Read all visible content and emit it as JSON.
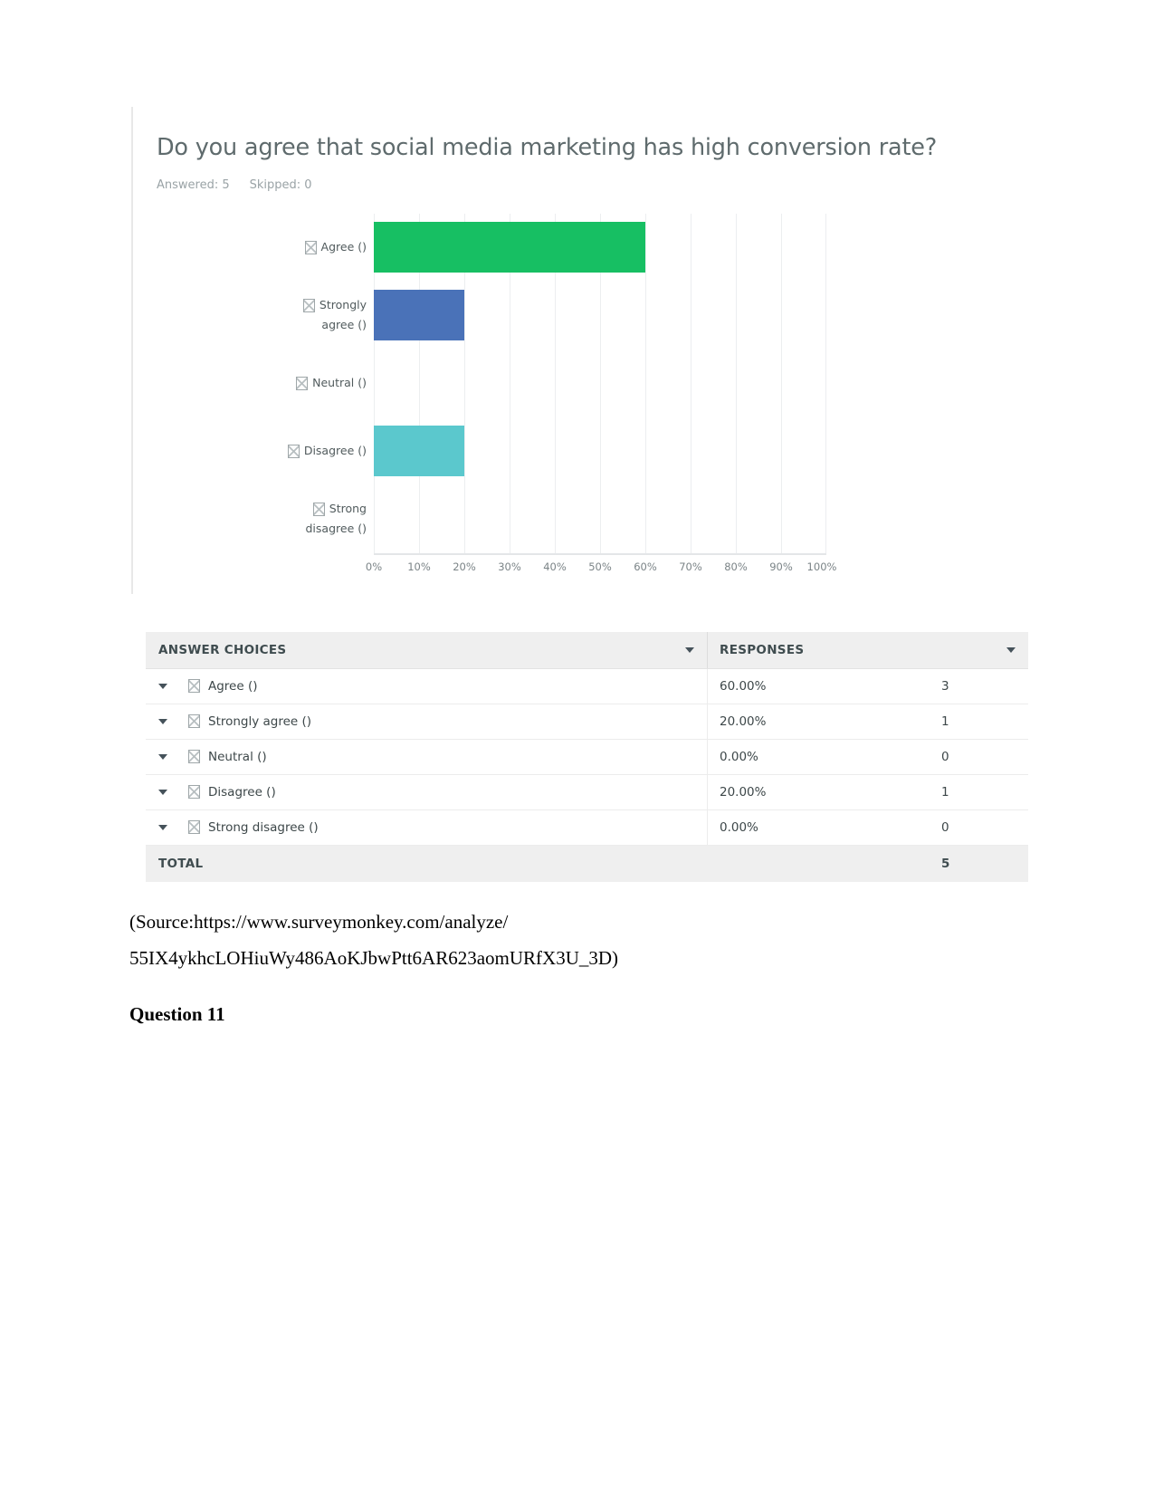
{
  "survey": {
    "question_title": "Do you agree that social media marketing has high conversion rate?",
    "answered_label": "Answered: 5",
    "skipped_label": "Skipped: 0"
  },
  "chart_data": {
    "type": "bar",
    "orientation": "horizontal",
    "title": "Do you agree that social media marketing has high conversion rate?",
    "xlabel": "",
    "ylabel": "",
    "xlim": [
      0,
      100
    ],
    "grid": true,
    "legend": "none",
    "categories": [
      "Agree ()",
      "Strongly agree ()",
      "Neutral ()",
      "Disagree ()",
      "Strong disagree ()"
    ],
    "values": [
      60.0,
      20.0,
      0.0,
      20.0,
      0.0
    ],
    "counts": [
      3,
      1,
      0,
      1,
      0
    ],
    "colors": [
      "#17bf63",
      "#4a72b8",
      "#5bc8cd",
      "#17bf63",
      "#4a72b8"
    ],
    "bar_colors_used": [
      "#17bf63",
      "#4a72b8",
      "none",
      "#5bc8cd",
      "none"
    ],
    "tick_labels": [
      "0%",
      "10%",
      "20%",
      "30%",
      "40%",
      "50%",
      "60%",
      "70%",
      "80%",
      "90%",
      "100%"
    ],
    "tick_values": [
      0,
      10,
      20,
      30,
      40,
      50,
      60,
      70,
      80,
      90,
      100
    ]
  },
  "chart": {
    "bars": [
      {
        "label_line1": "Agree ()",
        "label_line2": "",
        "value": 60,
        "color": "#17bf63",
        "visible": true
      },
      {
        "label_line1": "Strongly",
        "label_line2": "agree ()",
        "value": 20,
        "color": "#4a72b8",
        "visible": true
      },
      {
        "label_line1": "Neutral ()",
        "label_line2": "",
        "value": 0,
        "color": "#5bc8cd",
        "visible": false
      },
      {
        "label_line1": "Disagree ()",
        "label_line2": "",
        "value": 20,
        "color": "#5bc8cd",
        "visible": true
      },
      {
        "label_line1": "Strong",
        "label_line2": "disagree ()",
        "value": 0,
        "color": "#4a72b8",
        "visible": false
      }
    ]
  },
  "table": {
    "columns": {
      "answer_choices": "ANSWER CHOICES",
      "responses": "RESPONSES"
    },
    "rows": [
      {
        "choice": "Agree ()",
        "percent": "60.00%",
        "count": "3"
      },
      {
        "choice": "Strongly agree ()",
        "percent": "20.00%",
        "count": "1"
      },
      {
        "choice": "Neutral ()",
        "percent": "0.00%",
        "count": "0"
      },
      {
        "choice": "Disagree ()",
        "percent": "20.00%",
        "count": "1"
      },
      {
        "choice": "Strong disagree ()",
        "percent": "0.00%",
        "count": "0"
      }
    ],
    "total_label": "TOTAL",
    "total_value": "5"
  },
  "document": {
    "source_line_1": "(Source:https://www.surveymonkey.com/analyze/",
    "source_line_2": "55IX4ykhcLOHiuWy486AoKJbwPtt6AR623aomURfX3U_3D)",
    "question_heading": "Question 11"
  },
  "colors": {
    "green": "#17bf63",
    "blue": "#4a72b8",
    "teal": "#5bc8cd",
    "header_bg": "#efefef",
    "title_text": "#5f6b6d"
  }
}
